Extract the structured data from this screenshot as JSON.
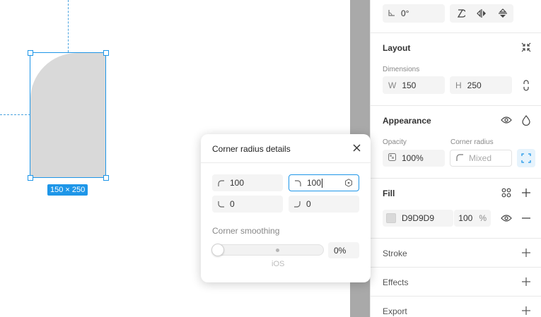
{
  "canvas": {
    "selection_size": "150 × 250"
  },
  "panel": {
    "rotation": {
      "value": "0°"
    },
    "layout": {
      "title": "Layout",
      "dimensions_label": "Dimensions",
      "width": {
        "prefix": "W",
        "value": "150"
      },
      "height": {
        "prefix": "H",
        "value": "250"
      }
    },
    "appearance": {
      "title": "Appearance",
      "opacity_label": "Opacity",
      "opacity_value": "100%",
      "radius_label": "Corner radius",
      "radius_value": "Mixed"
    },
    "fill": {
      "title": "Fill",
      "hex": "D9D9D9",
      "swatch_color": "#D9D9D9",
      "opacity": "100",
      "opacity_unit": "%"
    },
    "stroke": {
      "title": "Stroke"
    },
    "effects": {
      "title": "Effects"
    },
    "export": {
      "title": "Export"
    }
  },
  "popover": {
    "title": "Corner radius details",
    "top_left": "100",
    "top_right": "100",
    "bottom_left": "0",
    "bottom_right": "0",
    "smoothing_label": "Corner smoothing",
    "smoothing_value": "0%",
    "ios_label": "iOS"
  },
  "colors": {
    "accent": "#1E96E8",
    "shape_fill": "#D9D9D9"
  }
}
